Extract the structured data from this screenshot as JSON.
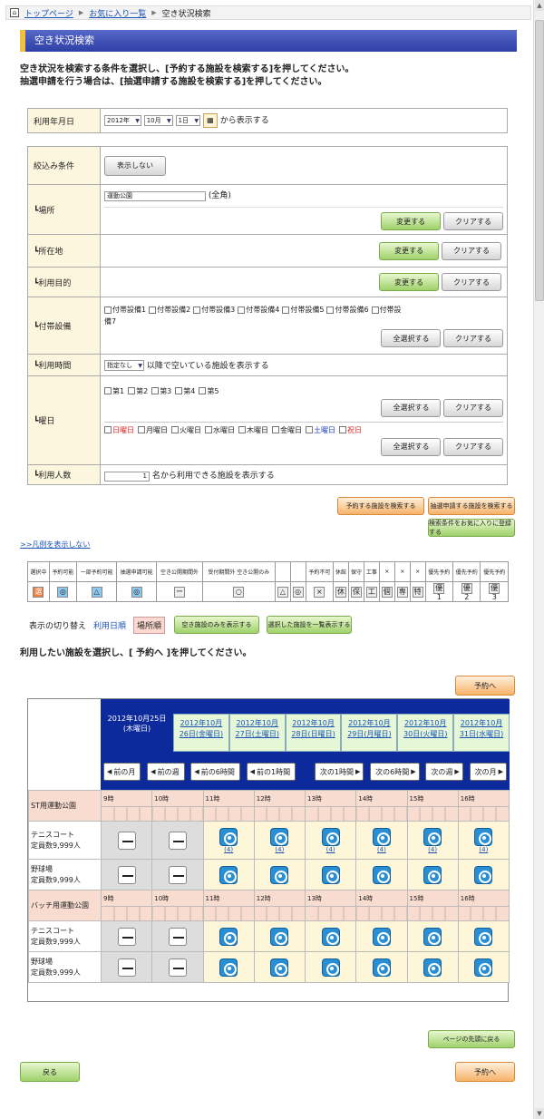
{
  "breadcrumb": {
    "home": "トップページ",
    "favorites": "お気に入り一覧",
    "current": "空き状況検索"
  },
  "page_title": "空き状況検索",
  "intro": {
    "line1": "空き状況を検索する条件を選択し、[予約する施設を検索する]を押してください。",
    "line2": "抽選申請を行う場合は、[抽選申請する施設を検索する]を押してください。"
  },
  "date_row": {
    "label": "利用年月日",
    "year": "2012年",
    "month": "10月",
    "day": "1日",
    "suffix": "から表示する"
  },
  "filter": {
    "label": "絞込み条件",
    "toggle": "表示しない"
  },
  "place": {
    "label": "┗場所",
    "value": "運動公園",
    "suffix": "(全角)"
  },
  "location": {
    "label": "┗所在地"
  },
  "purpose": {
    "label": "┗利用目的"
  },
  "equipment": {
    "label": "┗付帯設備",
    "items": [
      "付帯設備1",
      "付帯設備2",
      "付帯設備3",
      "付帯設備4",
      "付帯設備5",
      "付帯設備6",
      "付帯設"
    ],
    "wrap": "備7"
  },
  "time": {
    "label": "┗利用時間",
    "select": "指定なし",
    "suffix": "以降で空いている施設を表示する"
  },
  "weekday": {
    "label": "┗曜日",
    "weeks": [
      "第1",
      "第2",
      "第3",
      "第4",
      "第5"
    ],
    "days": [
      "日曜日",
      "月曜日",
      "火曜日",
      "水曜日",
      "木曜日",
      "金曜日",
      "土曜日",
      "祝日"
    ]
  },
  "people": {
    "label": "┗利用人数",
    "value": "1",
    "suffix": "名から利用できる施設を表示する"
  },
  "buttons": {
    "change": "変更する",
    "clear": "クリアする",
    "select_all": "全選択する",
    "search_reserve": "予約する施設を検索する",
    "search_lottery": "抽選申請する施設を検索する",
    "save_favorite": "検索条件をお気に入りに登録する",
    "show_avail": "空き施設のみを表示する",
    "show_selected": "選択した施設を一覧表示する",
    "reserve": "予約へ",
    "back": "戻る",
    "page_top": "ページの先頭に戻る"
  },
  "legend_link": ">>凡例を表示しない",
  "legend": {
    "headers": [
      "選択中",
      "予約可能",
      "一部予約可能",
      "抽選申請可能",
      "空き公開期間外",
      "受付期間外 空き公開のみ",
      "",
      "",
      "予約不可",
      "休館",
      "保守",
      "工事",
      "×",
      "×",
      "×",
      "優先予約",
      "優先予約",
      "優先予約"
    ],
    "icons": [
      "選",
      "◎",
      "△",
      "◎",
      "ー",
      "○",
      "△",
      "◎",
      "×",
      "休",
      "保",
      "工",
      "個",
      "専",
      "特",
      "優1",
      "優2",
      "優3"
    ]
  },
  "sort": {
    "label": "表示の切り替え",
    "by_date": "利用日順",
    "by_place": "場所順"
  },
  "instruction": "利用したい施設を選択し、[ 予約へ ]を押してください。",
  "calendar": {
    "current_date": "2012年10月25日",
    "current_day": "(木曜日)",
    "other_dates": [
      "2012年10月26日(金曜日)",
      "2012年10月27日(土曜日)",
      "2012年10月28日(日曜日)",
      "2012年10月29日(月曜日)",
      "2012年10月30日(火曜日)",
      "2012年10月31日(水曜日)"
    ],
    "nav": [
      "前の月",
      "前の週",
      "前の6時間",
      "前の1時間",
      "次の1時間",
      "次の6時間",
      "次の週",
      "次の月"
    ],
    "hours": [
      "9時",
      "10時",
      "11時",
      "12時",
      "13時",
      "14時",
      "15時",
      "16時"
    ],
    "parks": [
      {
        "name": "ST用運動公園",
        "facilities": [
          {
            "name": "テニスコート",
            "cap": "定員数9,999人",
            "count": "(4)"
          },
          {
            "name": "野球場",
            "cap": "定員数9,999人",
            "count": ""
          }
        ]
      },
      {
        "name": "バッチ用運動公園",
        "facilities": [
          {
            "name": "テニスコート",
            "cap": "定員数9,999人",
            "count": ""
          },
          {
            "name": "野球場",
            "cap": "定員数9,999人",
            "count": ""
          }
        ]
      }
    ]
  }
}
